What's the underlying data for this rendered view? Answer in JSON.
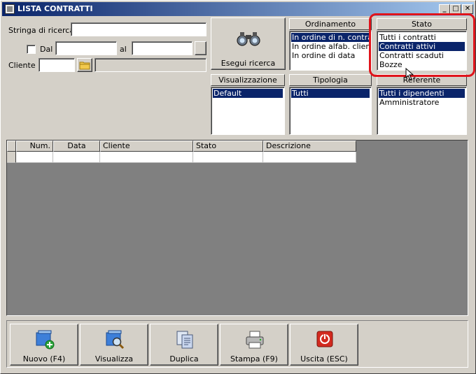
{
  "window": {
    "title": "LISTA CONTRATTI",
    "min_btn": "_",
    "max_btn": "□",
    "close_btn": "✕"
  },
  "search": {
    "string_label": "Stringa di ricerca :",
    "string_value": "",
    "dal_label": "Dal",
    "dal_value": "",
    "al_label": "al",
    "al_value": "",
    "cliente_label": "Cliente :",
    "cliente_value": "",
    "cliente_name": "",
    "execute_label": "Esegui ricerca"
  },
  "groups": {
    "ordinamento": {
      "title": "Ordinamento",
      "items": [
        "In ordine di n. contratto",
        "In ordine alfab. cliente",
        "In ordine di data"
      ],
      "selected": 0
    },
    "stato": {
      "title": "Stato",
      "items": [
        "Tutti i contratti",
        "Contratti attivi",
        "Contratti scaduti",
        "Bozze"
      ],
      "selected": 1
    },
    "visualizzazione": {
      "title": "Visualizzazione",
      "items": [
        "Default"
      ],
      "selected": 0
    },
    "tipologia": {
      "title": "Tipologia",
      "items": [
        "Tutti"
      ],
      "selected": 0
    },
    "referente": {
      "title": "Referente",
      "items": [
        "Tutti i dipendenti",
        "Amministratore"
      ],
      "selected": 0
    }
  },
  "grid": {
    "columns": [
      "Num.",
      "Data",
      "Cliente",
      "Stato",
      "Descrizione"
    ]
  },
  "actions": {
    "nuovo": "Nuovo (F4)",
    "visualizza": "Visualizza",
    "duplica": "Duplica",
    "stampa": "Stampa (F9)",
    "uscita": "Uscita (ESC)"
  },
  "icons": {
    "window": "app-icon",
    "binoculars": "binoculars-icon",
    "folder": "folder-icon",
    "nuovo": "new-document-icon",
    "visualizza": "view-document-icon",
    "duplica": "duplicate-icon",
    "stampa": "printer-icon",
    "uscita": "exit-icon"
  },
  "colors": {
    "selection": "#0a246a",
    "highlight": "#e0141b",
    "titlebar": "#0a246a"
  }
}
